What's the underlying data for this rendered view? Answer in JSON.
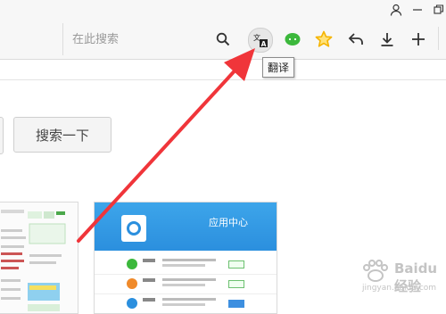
{
  "window_controls": {
    "user_icon": "user-icon",
    "restore_icon": "restore-icon"
  },
  "toolbar": {
    "search_placeholder": "在此搜索",
    "tooltip": "翻译"
  },
  "page": {
    "search_button": "搜索一下"
  },
  "thumbnails": {
    "app_center_title": "应用中心"
  },
  "watermark": {
    "text": "Baidu经验",
    "url": "jingyan.baidu.com"
  },
  "colors": {
    "arrow": "#f0353a",
    "accent_blue": "#2b8fde",
    "star": "#f5b400",
    "chat_green": "#3cb83c"
  }
}
